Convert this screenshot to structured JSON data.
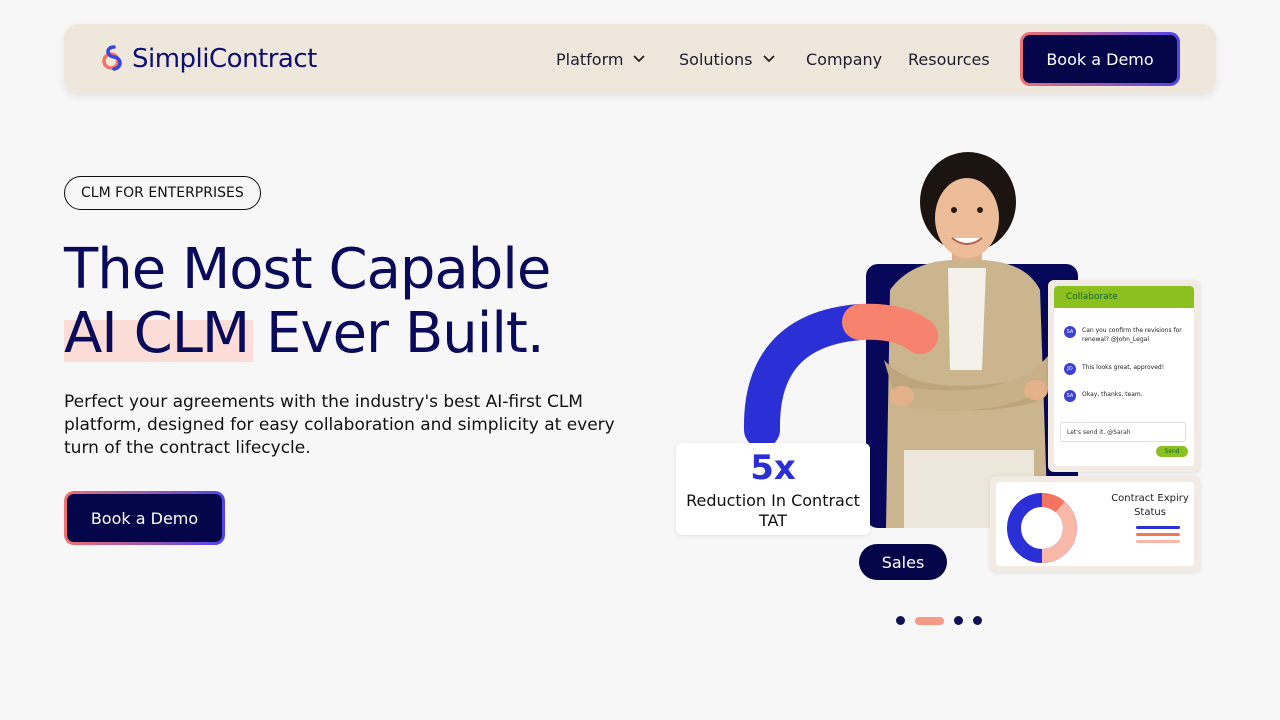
{
  "nav": {
    "brand": "SimpliContract",
    "items": [
      {
        "label": "Platform",
        "has_dropdown": true
      },
      {
        "label": "Solutions",
        "has_dropdown": true
      },
      {
        "label": "Company",
        "has_dropdown": false
      },
      {
        "label": "Resources",
        "has_dropdown": false
      }
    ],
    "cta_label": "Book a Demo"
  },
  "hero": {
    "tag": "CLM FOR ENTERPRISES",
    "headline_line1": "The Most Capable",
    "headline_highlight": "AI CLM",
    "headline_line2_rest": " Ever Built.",
    "subtext": "Perfect your agreements with the industry's best AI-first CLM platform, designed for easy collaboration and simplicity at every turn of the contract lifecycle.",
    "cta_label": "Book a Demo"
  },
  "visual": {
    "stat_value": "5x",
    "stat_label": "Reduction In Contract TAT",
    "collab_title": "Collaborate",
    "messages": [
      {
        "avatar": "SA",
        "text": "Can you confirm the revisions for renewal? @John_Legal"
      },
      {
        "avatar": "JO",
        "text": "This looks great, approved!"
      },
      {
        "avatar": "SA",
        "text": "Okay, thanks, team."
      }
    ],
    "reply_text": "Let's send it. @Sarah",
    "send_label": "Send",
    "expiry_title": "Contract Expiry Status",
    "pill_label": "Sales"
  },
  "carousel": {
    "slide_count": 4,
    "active_index": 1
  },
  "colors": {
    "navy": "#05054a",
    "brand_blue": "#2b2fd6",
    "coral": "#f69a86",
    "green": "#8cc01e",
    "nav_bg": "#efe7dc"
  }
}
